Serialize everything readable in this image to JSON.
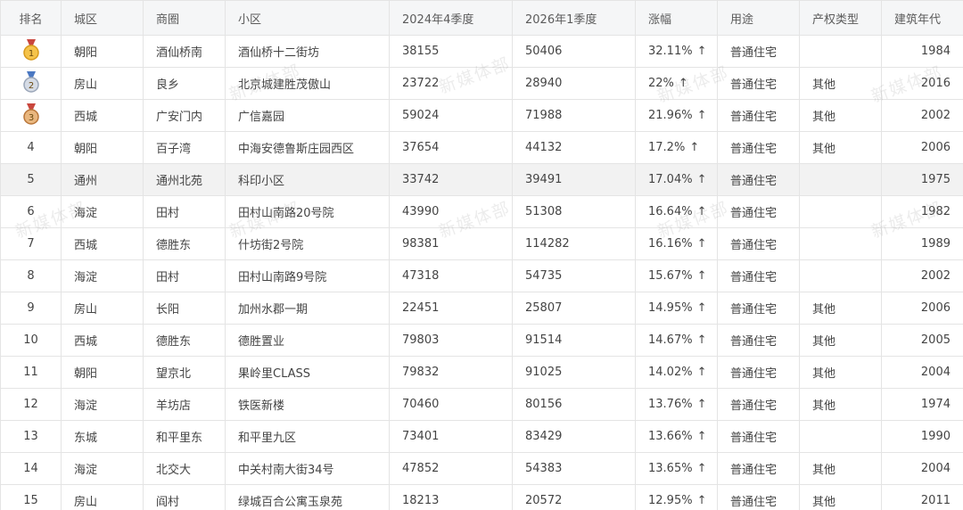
{
  "watermark": "新媒体部",
  "columns": [
    "排名",
    "城区",
    "商圈",
    "小区",
    "2024年4季度",
    "2026年1季度",
    "涨幅",
    "用途",
    "产权类型",
    "建筑年代"
  ],
  "rows": [
    {
      "rank": "1",
      "medal": "gold-medal-icon",
      "district": "朝阳",
      "area": "酒仙桥南",
      "community": "酒仙桥十二街坊",
      "q2024": "38155",
      "q2026": "50406",
      "rise": "32.11%",
      "arrow": "↑",
      "use": "普通住宅",
      "ptype": "",
      "year": "1984"
    },
    {
      "rank": "2",
      "medal": "silver-medal-icon",
      "district": "房山",
      "area": "良乡",
      "community": "北京城建胜茂傲山",
      "q2024": "23722",
      "q2026": "28940",
      "rise": "22%",
      "arrow": "↑",
      "use": "普通住宅",
      "ptype": "其他",
      "year": "2016"
    },
    {
      "rank": "3",
      "medal": "bronze-medal-icon",
      "district": "西城",
      "area": "广安门内",
      "community": "广信嘉园",
      "q2024": "59024",
      "q2026": "71988",
      "rise": "21.96%",
      "arrow": "↑",
      "use": "普通住宅",
      "ptype": "其他",
      "year": "2002"
    },
    {
      "rank": "4",
      "district": "朝阳",
      "area": "百子湾",
      "community": "中海安德鲁斯庄园西区",
      "q2024": "37654",
      "q2026": "44132",
      "rise": "17.2%",
      "arrow": "↑",
      "use": "普通住宅",
      "ptype": "其他",
      "year": "2006"
    },
    {
      "rank": "5",
      "district": "通州",
      "area": "通州北苑",
      "community": "科印小区",
      "q2024": "33742",
      "q2026": "39491",
      "rise": "17.04%",
      "arrow": "↑",
      "use": "普通住宅",
      "ptype": "",
      "year": "1975"
    },
    {
      "rank": "6",
      "district": "海淀",
      "area": "田村",
      "community": "田村山南路20号院",
      "q2024": "43990",
      "q2026": "51308",
      "rise": "16.64%",
      "arrow": "↑",
      "use": "普通住宅",
      "ptype": "",
      "year": "1982"
    },
    {
      "rank": "7",
      "district": "西城",
      "area": "德胜东",
      "community": "什坊街2号院",
      "q2024": "98381",
      "q2026": "114282",
      "rise": "16.16%",
      "arrow": "↑",
      "use": "普通住宅",
      "ptype": "",
      "year": "1989"
    },
    {
      "rank": "8",
      "district": "海淀",
      "area": "田村",
      "community": "田村山南路9号院",
      "q2024": "47318",
      "q2026": "54735",
      "rise": "15.67%",
      "arrow": "↑",
      "use": "普通住宅",
      "ptype": "",
      "year": "2002"
    },
    {
      "rank": "9",
      "district": "房山",
      "area": "长阳",
      "community": "加州水郡一期",
      "q2024": "22451",
      "q2026": "25807",
      "rise": "14.95%",
      "arrow": "↑",
      "use": "普通住宅",
      "ptype": "其他",
      "year": "2006"
    },
    {
      "rank": "10",
      "district": "西城",
      "area": "德胜东",
      "community": "德胜置业",
      "q2024": "79803",
      "q2026": "91514",
      "rise": "14.67%",
      "arrow": "↑",
      "use": "普通住宅",
      "ptype": "其他",
      "year": "2005"
    },
    {
      "rank": "11",
      "district": "朝阳",
      "area": "望京北",
      "community": "果岭里CLASS",
      "q2024": "79832",
      "q2026": "91025",
      "rise": "14.02%",
      "arrow": "↑",
      "use": "普通住宅",
      "ptype": "其他",
      "year": "2004"
    },
    {
      "rank": "12",
      "district": "海淀",
      "area": "羊坊店",
      "community": "铁医新楼",
      "q2024": "70460",
      "q2026": "80156",
      "rise": "13.76%",
      "arrow": "↑",
      "use": "普通住宅",
      "ptype": "其他",
      "year": "1974"
    },
    {
      "rank": "13",
      "district": "东城",
      "area": "和平里东",
      "community": "和平里九区",
      "q2024": "73401",
      "q2026": "83429",
      "rise": "13.66%",
      "arrow": "↑",
      "use": "普通住宅",
      "ptype": "",
      "year": "1990"
    },
    {
      "rank": "14",
      "district": "海淀",
      "area": "北交大",
      "community": "中关村南大街34号",
      "q2024": "47852",
      "q2026": "54383",
      "rise": "13.65%",
      "arrow": "↑",
      "use": "普通住宅",
      "ptype": "其他",
      "year": "2004"
    },
    {
      "rank": "15",
      "district": "房山",
      "area": "阎村",
      "community": "绿城百合公寓玉泉苑",
      "q2024": "18213",
      "q2026": "20572",
      "rise": "12.95%",
      "arrow": "↑",
      "use": "普通住宅",
      "ptype": "其他",
      "year": "2011"
    }
  ],
  "highlight_row": 5
}
